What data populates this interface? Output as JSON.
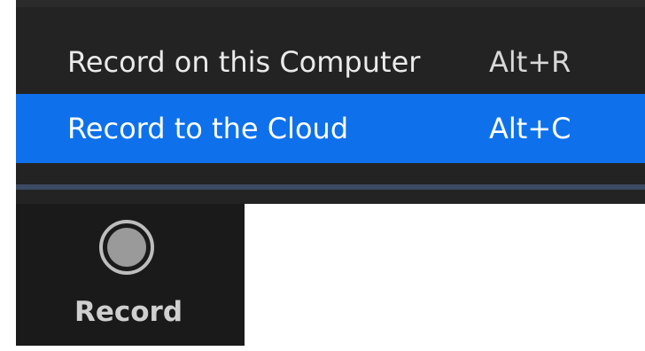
{
  "record_menu": {
    "items": [
      {
        "label": "Record on this Computer",
        "shortcut": "Alt+R",
        "highlighted": false
      },
      {
        "label": "Record to the Cloud",
        "shortcut": "Alt+C",
        "highlighted": true
      }
    ]
  },
  "toolbar": {
    "record_label": "Record",
    "record_icon": "record-icon"
  },
  "colors": {
    "menu_background": "#232323",
    "highlight": "#0e71eb",
    "toolbar_background": "#1a1a1a"
  }
}
